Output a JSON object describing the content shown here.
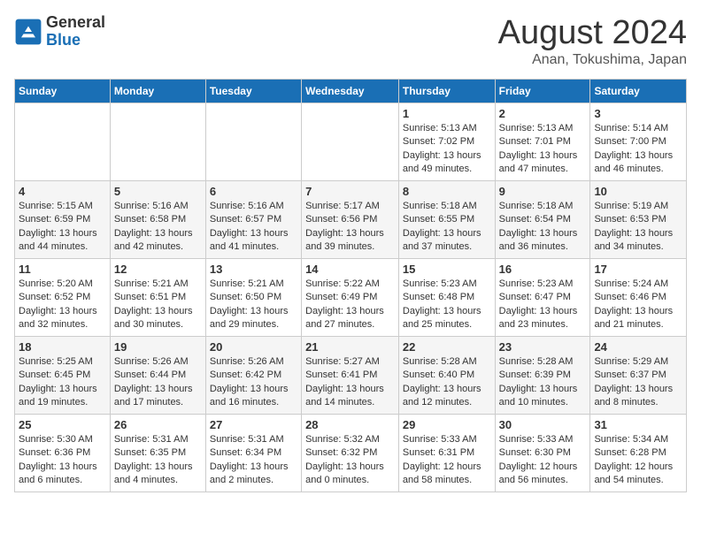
{
  "header": {
    "logo_general": "General",
    "logo_blue": "Blue",
    "title": "August 2024",
    "location": "Anan, Tokushima, Japan"
  },
  "days_of_week": [
    "Sunday",
    "Monday",
    "Tuesday",
    "Wednesday",
    "Thursday",
    "Friday",
    "Saturday"
  ],
  "weeks": [
    [
      {
        "day": "",
        "info": ""
      },
      {
        "day": "",
        "info": ""
      },
      {
        "day": "",
        "info": ""
      },
      {
        "day": "",
        "info": ""
      },
      {
        "day": "1",
        "info": "Sunrise: 5:13 AM\nSunset: 7:02 PM\nDaylight: 13 hours and 49 minutes."
      },
      {
        "day": "2",
        "info": "Sunrise: 5:13 AM\nSunset: 7:01 PM\nDaylight: 13 hours and 47 minutes."
      },
      {
        "day": "3",
        "info": "Sunrise: 5:14 AM\nSunset: 7:00 PM\nDaylight: 13 hours and 46 minutes."
      }
    ],
    [
      {
        "day": "4",
        "info": "Sunrise: 5:15 AM\nSunset: 6:59 PM\nDaylight: 13 hours and 44 minutes."
      },
      {
        "day": "5",
        "info": "Sunrise: 5:16 AM\nSunset: 6:58 PM\nDaylight: 13 hours and 42 minutes."
      },
      {
        "day": "6",
        "info": "Sunrise: 5:16 AM\nSunset: 6:57 PM\nDaylight: 13 hours and 41 minutes."
      },
      {
        "day": "7",
        "info": "Sunrise: 5:17 AM\nSunset: 6:56 PM\nDaylight: 13 hours and 39 minutes."
      },
      {
        "day": "8",
        "info": "Sunrise: 5:18 AM\nSunset: 6:55 PM\nDaylight: 13 hours and 37 minutes."
      },
      {
        "day": "9",
        "info": "Sunrise: 5:18 AM\nSunset: 6:54 PM\nDaylight: 13 hours and 36 minutes."
      },
      {
        "day": "10",
        "info": "Sunrise: 5:19 AM\nSunset: 6:53 PM\nDaylight: 13 hours and 34 minutes."
      }
    ],
    [
      {
        "day": "11",
        "info": "Sunrise: 5:20 AM\nSunset: 6:52 PM\nDaylight: 13 hours and 32 minutes."
      },
      {
        "day": "12",
        "info": "Sunrise: 5:21 AM\nSunset: 6:51 PM\nDaylight: 13 hours and 30 minutes."
      },
      {
        "day": "13",
        "info": "Sunrise: 5:21 AM\nSunset: 6:50 PM\nDaylight: 13 hours and 29 minutes."
      },
      {
        "day": "14",
        "info": "Sunrise: 5:22 AM\nSunset: 6:49 PM\nDaylight: 13 hours and 27 minutes."
      },
      {
        "day": "15",
        "info": "Sunrise: 5:23 AM\nSunset: 6:48 PM\nDaylight: 13 hours and 25 minutes."
      },
      {
        "day": "16",
        "info": "Sunrise: 5:23 AM\nSunset: 6:47 PM\nDaylight: 13 hours and 23 minutes."
      },
      {
        "day": "17",
        "info": "Sunrise: 5:24 AM\nSunset: 6:46 PM\nDaylight: 13 hours and 21 minutes."
      }
    ],
    [
      {
        "day": "18",
        "info": "Sunrise: 5:25 AM\nSunset: 6:45 PM\nDaylight: 13 hours and 19 minutes."
      },
      {
        "day": "19",
        "info": "Sunrise: 5:26 AM\nSunset: 6:44 PM\nDaylight: 13 hours and 17 minutes."
      },
      {
        "day": "20",
        "info": "Sunrise: 5:26 AM\nSunset: 6:42 PM\nDaylight: 13 hours and 16 minutes."
      },
      {
        "day": "21",
        "info": "Sunrise: 5:27 AM\nSunset: 6:41 PM\nDaylight: 13 hours and 14 minutes."
      },
      {
        "day": "22",
        "info": "Sunrise: 5:28 AM\nSunset: 6:40 PM\nDaylight: 13 hours and 12 minutes."
      },
      {
        "day": "23",
        "info": "Sunrise: 5:28 AM\nSunset: 6:39 PM\nDaylight: 13 hours and 10 minutes."
      },
      {
        "day": "24",
        "info": "Sunrise: 5:29 AM\nSunset: 6:37 PM\nDaylight: 13 hours and 8 minutes."
      }
    ],
    [
      {
        "day": "25",
        "info": "Sunrise: 5:30 AM\nSunset: 6:36 PM\nDaylight: 13 hours and 6 minutes."
      },
      {
        "day": "26",
        "info": "Sunrise: 5:31 AM\nSunset: 6:35 PM\nDaylight: 13 hours and 4 minutes."
      },
      {
        "day": "27",
        "info": "Sunrise: 5:31 AM\nSunset: 6:34 PM\nDaylight: 13 hours and 2 minutes."
      },
      {
        "day": "28",
        "info": "Sunrise: 5:32 AM\nSunset: 6:32 PM\nDaylight: 13 hours and 0 minutes."
      },
      {
        "day": "29",
        "info": "Sunrise: 5:33 AM\nSunset: 6:31 PM\nDaylight: 12 hours and 58 minutes."
      },
      {
        "day": "30",
        "info": "Sunrise: 5:33 AM\nSunset: 6:30 PM\nDaylight: 12 hours and 56 minutes."
      },
      {
        "day": "31",
        "info": "Sunrise: 5:34 AM\nSunset: 6:28 PM\nDaylight: 12 hours and 54 minutes."
      }
    ]
  ]
}
